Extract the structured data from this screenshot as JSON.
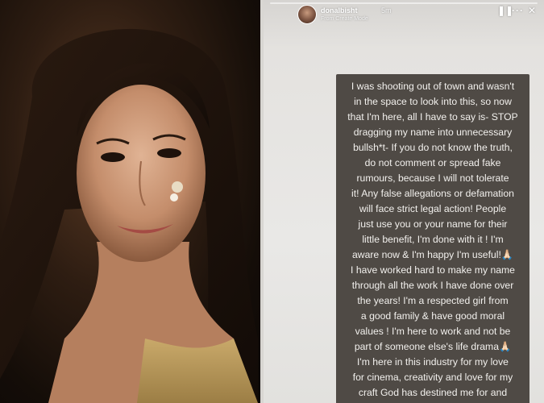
{
  "story": {
    "username": "donalbisht",
    "time": "5m",
    "source": "From Create Mode",
    "controls": {
      "pause": "❚❚",
      "more": "···",
      "close": "✕"
    },
    "lines": [
      "I was shooting out of town and wasn't",
      "in the space to look into this, so now",
      "that I'm here, all I have to say is- STOP",
      "dragging my name into unnecessary",
      "bullsh*t- If you do not know the truth,",
      "do not comment or spread fake",
      "rumours, because I will not tolerate",
      "it! Any false allegations or defamation",
      "will face strict legal action! People",
      "just use you or your name for their",
      "little benefit, I'm done with it ! I'm",
      "aware now & I'm happy I'm useful!🙏🏻",
      "I have worked hard to make my name",
      "through all the work I have done over",
      "the years! I'm a respected girl from",
      "a good family & have good moral",
      "values ! I'm here to work and not be",
      "part of someone else's life drama🙏🏻",
      "I'm here in this industry for my love",
      "for cinema, creativity and love for my",
      "craft God has destined me for and"
    ]
  },
  "colors": {
    "story_bg": "#e9e8e6",
    "text_box": "#4f4a45",
    "text": "#f2f0ed"
  }
}
